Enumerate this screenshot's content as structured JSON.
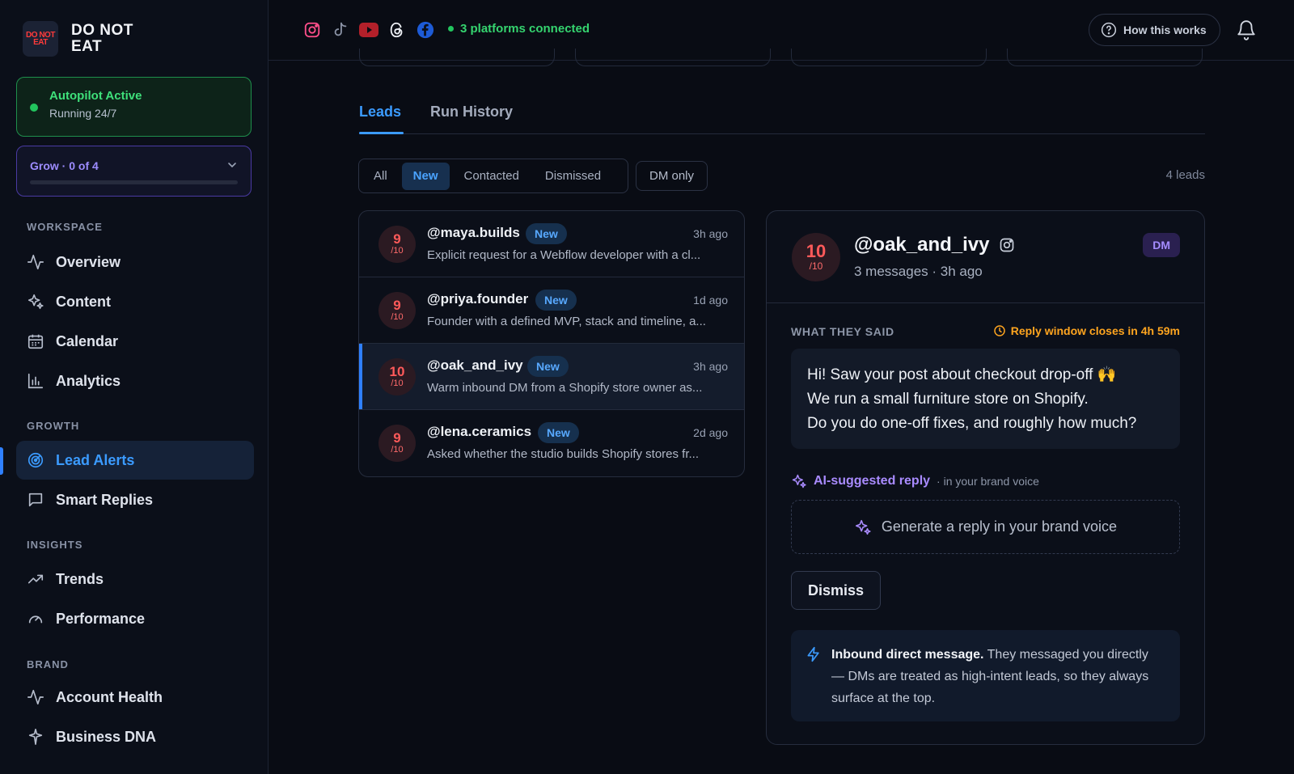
{
  "brand": {
    "logo_line1": "DO NOT",
    "logo_line2": "EAT",
    "name_line1": "DO NOT",
    "name_line2": "EAT"
  },
  "autopilot": {
    "title": "Autopilot Active",
    "subtitle": "Running 24/7",
    "status_color": "#22c55e"
  },
  "plan": {
    "label": "Grow · 0 of 4",
    "progress": 0
  },
  "sidebar": {
    "sections": [
      {
        "heading": "WORKSPACE",
        "items": [
          {
            "label": "Overview",
            "icon": "activity-icon"
          },
          {
            "label": "Content",
            "icon": "sparkles-icon"
          },
          {
            "label": "Calendar",
            "icon": "calendar-icon"
          },
          {
            "label": "Analytics",
            "icon": "bar-chart-icon"
          }
        ]
      },
      {
        "heading": "GROWTH",
        "items": [
          {
            "label": "Lead Alerts",
            "icon": "radar-icon",
            "active": true
          },
          {
            "label": "Smart Replies",
            "icon": "message-square-icon"
          }
        ]
      },
      {
        "heading": "INSIGHTS",
        "items": [
          {
            "label": "Trends",
            "icon": "trending-up-icon"
          },
          {
            "label": "Performance",
            "icon": "gauge-icon"
          }
        ]
      },
      {
        "heading": "BRAND",
        "items": [
          {
            "label": "Account Health",
            "icon": "activity-icon"
          },
          {
            "label": "Business DNA",
            "icon": "dna-icon"
          }
        ]
      }
    ]
  },
  "topbar": {
    "platforms": [
      "instagram-icon",
      "tiktok-icon",
      "youtube-icon",
      "threads-icon",
      "facebook-icon"
    ],
    "connected_text": "3 platforms connected",
    "how_label": "How this works"
  },
  "tabs": {
    "leads": "Leads",
    "history": "Run History"
  },
  "filters": {
    "all": "All",
    "new": "New",
    "contacted": "Contacted",
    "dismissed": "Dismissed",
    "dm_only": "DM only",
    "count": "4 leads"
  },
  "leads": [
    {
      "score": "9",
      "denom": "/10",
      "handle": "@maya.builds",
      "badge": "New",
      "ago": "3h ago",
      "snippet": "Explicit request for a Webflow developer with a cl..."
    },
    {
      "score": "9",
      "denom": "/10",
      "handle": "@priya.founder",
      "badge": "New",
      "ago": "1d ago",
      "snippet": "Founder with a defined MVP, stack and timeline, a..."
    },
    {
      "score": "10",
      "denom": "/10",
      "handle": "@oak_and_ivy",
      "badge": "New",
      "ago": "3h ago",
      "snippet": "Warm inbound DM from a Shopify store owner as..."
    },
    {
      "score": "9",
      "denom": "/10",
      "handle": "@lena.ceramics",
      "badge": "New",
      "ago": "2d ago",
      "snippet": "Asked whether the studio builds Shopify stores fr..."
    }
  ],
  "detail": {
    "score": "10",
    "denom": "/10",
    "handle": "@oak_and_ivy",
    "meta": "3 messages · 3h ago",
    "channel_badge": "DM",
    "what_they_said": "WHAT THEY SAID",
    "reply_window": "Reply window closes in 4h 59m",
    "message_lines": [
      "Hi! Saw your post about checkout drop-off 🙌",
      "We run a small furniture store on Shopify.",
      "Do you do one-off fixes, and roughly how much?"
    ],
    "ai_label": "AI-suggested reply",
    "ai_sub": "· in your brand voice",
    "generate_label": "Generate a reply in your brand voice",
    "dismiss_label": "Dismiss",
    "info_bold": "Inbound direct message.",
    "info_text": " They messaged you directly — DMs are treated as high-intent leads, so they always surface at the top."
  }
}
